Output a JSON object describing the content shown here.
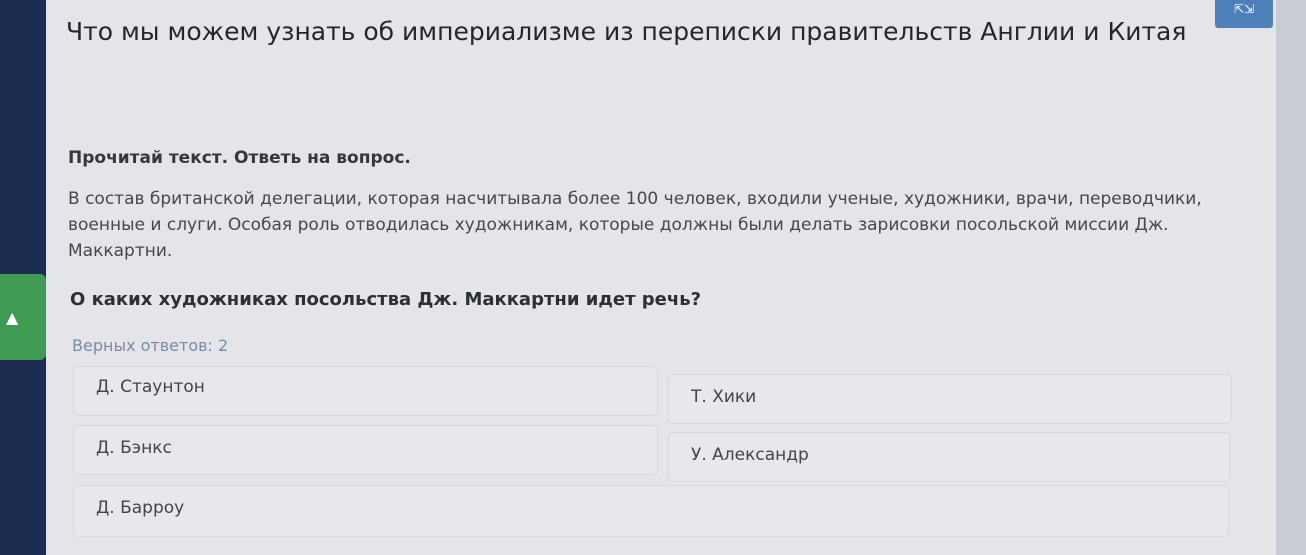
{
  "header": {
    "title": "Что мы можем узнать об империализме из переписки правительств Англии и Китая",
    "corner_icon": "expand-icon"
  },
  "task": {
    "instruction": "Прочитай текст. Ответь на вопрос.",
    "passage": "В состав британской делегации, которая насчитывала более 100 человек, входили ученые, художники, врачи, переводчики, военные и слуги. Особая роль отводилась художникам, которые должны были делать зарисовки посольской миссии Дж. Маккартни.",
    "question": "О каких художниках посольства Дж. Маккартни идет речь?",
    "answers_count": "Верных ответов: 2"
  },
  "options": {
    "left": [
      "Д. Стаунтон",
      "Д. Бэнкс",
      "Д. Барроу"
    ],
    "right": [
      "Т. Хики",
      "У. Александр"
    ]
  },
  "side_tab": {
    "icon": "chevron-up-icon"
  },
  "colors": {
    "rail": "#1c2b50",
    "panel": "#e4e5e9",
    "side_tab": "#3f9a52",
    "corner_button": "#4d7fb8"
  }
}
